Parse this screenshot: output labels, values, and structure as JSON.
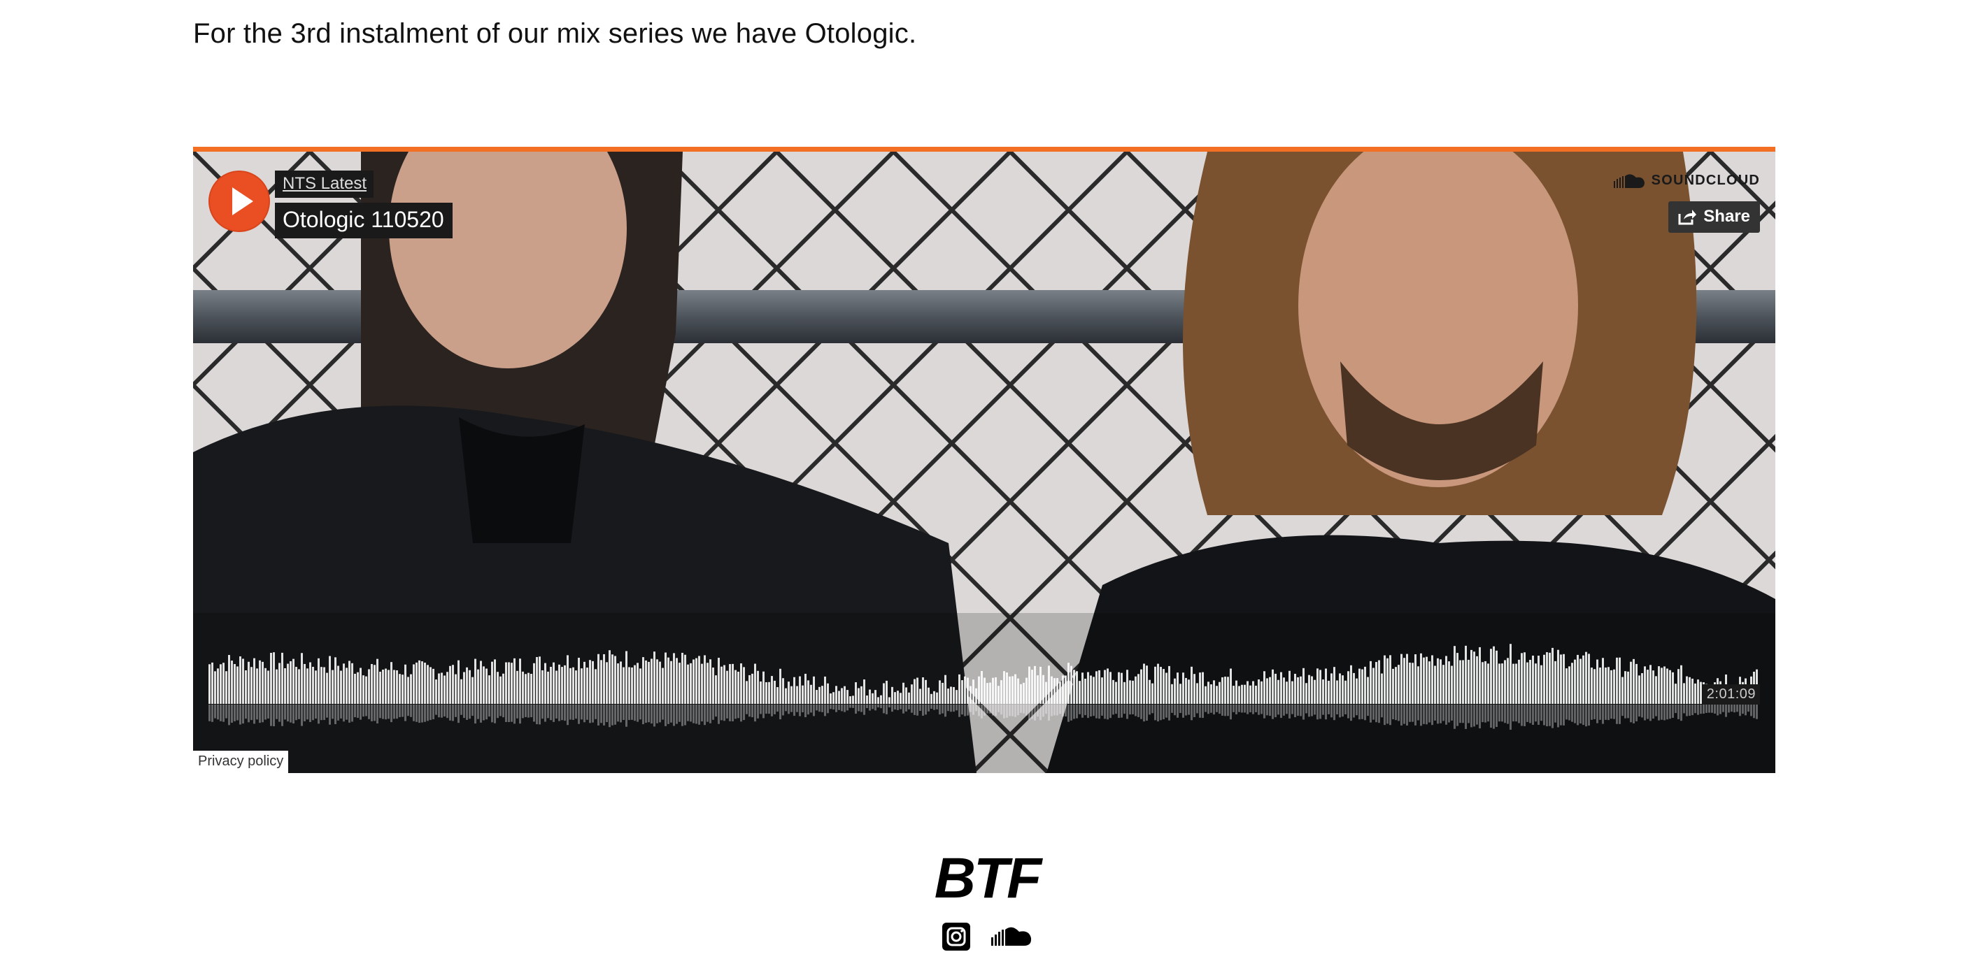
{
  "intro_text": "For the 3rd instalment of our mix series we have Otologic.",
  "player": {
    "uploader": "NTS Latest",
    "track_title": "Otologic 110520",
    "brand": "SOUNDCLOUD",
    "share_label": "Share",
    "duration": "2:01:09",
    "privacy_label": "Privacy policy",
    "accent_color": "#f26f23",
    "play_color": "#ea4f23"
  },
  "footer": {
    "logo": "BTF",
    "icons": [
      "instagram-icon",
      "soundcloud-icon"
    ]
  }
}
